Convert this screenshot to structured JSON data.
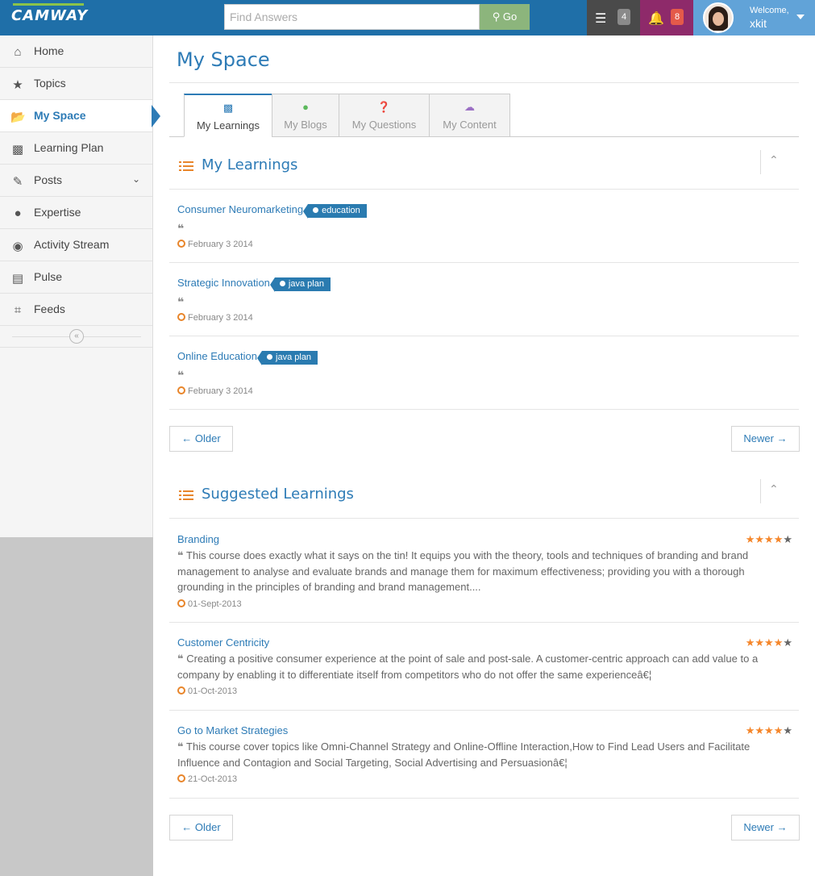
{
  "header": {
    "logo": "CAMWAY",
    "search_placeholder": "Find Answers",
    "go_label": "Go",
    "messages_count": "4",
    "notifications_count": "8",
    "welcome": "Welcome,",
    "username": "xkit"
  },
  "sidebar": {
    "items": [
      {
        "label": "Home"
      },
      {
        "label": "Topics"
      },
      {
        "label": "My Space"
      },
      {
        "label": "Learning Plan"
      },
      {
        "label": "Posts"
      },
      {
        "label": "Expertise"
      },
      {
        "label": "Activity Stream"
      },
      {
        "label": "Pulse"
      },
      {
        "label": "Feeds"
      }
    ]
  },
  "page": {
    "title": "My Space"
  },
  "tabs": [
    {
      "label": "My Learnings"
    },
    {
      "label": "My Blogs"
    },
    {
      "label": "My Questions"
    },
    {
      "label": "My Content"
    }
  ],
  "my_learnings": {
    "title": "My Learnings",
    "items": [
      {
        "title": "Consumer Neuromarketing",
        "tag": "education",
        "date": "February 3 2014"
      },
      {
        "title": "Strategic Innovation",
        "tag": "java plan",
        "date": "February 3 2014"
      },
      {
        "title": "Online Education",
        "tag": "java plan",
        "date": "February 3 2014"
      }
    ],
    "older": "← Older",
    "newer": "Newer →"
  },
  "suggested": {
    "title": "Suggested Learnings",
    "items": [
      {
        "title": "Branding",
        "rating": 4,
        "max_rating": 5,
        "desc": "This course does exactly what it says on the tin! It equips you with the theory, tools and techniques of branding and brand management to analyse and evaluate brands and manage them for maximum effectiveness; providing you with a thorough grounding in the principles of branding and brand management....",
        "date": "01-Sept-2013"
      },
      {
        "title": "Customer Centricity",
        "rating": 4,
        "max_rating": 5,
        "desc": "Creating a positive consumer experience at the point of sale and post-sale. A customer-centric approach can add value to a company by enabling it to differentiate itself from competitors who do not offer the same experienceâ€¦",
        "date": "01-Oct-2013"
      },
      {
        "title": "Go to Market Strategies",
        "rating": 4,
        "max_rating": 5,
        "desc": "This course cover topics like Omni-Channel Strategy and Online-Offline Interaction,How to Find Lead Users and Facilitate Influence and Contagion and Social Targeting, Social Advertising and Persuasionâ€¦",
        "date": "21-Oct-2013"
      }
    ],
    "older": "← Older",
    "newer": "Newer →"
  },
  "colors": {
    "accent": "#2d7bb6",
    "header": "#1f6fa8",
    "orange": "#e8852a"
  }
}
